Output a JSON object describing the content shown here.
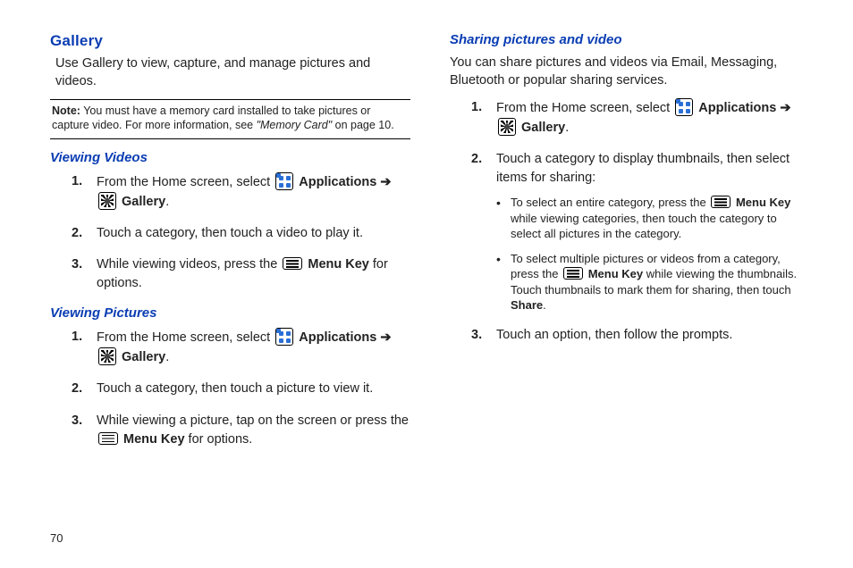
{
  "pageNumber": "70",
  "left": {
    "h1": "Gallery",
    "intro": "Use Gallery to view, capture, and manage pictures and videos.",
    "noteLabel": "Note:",
    "noteBody1": " You must have a memory card installed to take pictures or capture video. For more information, see ",
    "noteQuoted": "\"Memory Card\"",
    "noteBody2": " on page 10.",
    "sec1": {
      "title": "Viewing Videos",
      "s1a": "From the Home screen, select ",
      "s1apps": " Applications ",
      "s1arrow": "➔",
      "s1gal": " Gallery",
      "s1end": ".",
      "s2": "Touch a category, then touch a video to play it.",
      "s3a": "While viewing videos, press the ",
      "s3menu": " Menu Key",
      "s3b": " for options."
    },
    "sec2": {
      "title": "Viewing Pictures",
      "s1a": "From the Home screen, select ",
      "s1apps": " Applications ",
      "s1arrow": "➔",
      "s1gal": " Gallery",
      "s1end": ".",
      "s2": "Touch a category, then touch a picture to view it.",
      "s3a": "While viewing a picture, tap on the screen or press the ",
      "s3menu": " Menu Key",
      "s3b": " for options."
    }
  },
  "right": {
    "title": "Sharing pictures and video",
    "intro": "You can share pictures and videos via Email, Messaging, Bluetooth or popular sharing services.",
    "s1a": "From the Home screen, select ",
    "s1apps": " Applications ",
    "s1arrow": "➔",
    "s1gal": " Gallery",
    "s1end": ".",
    "s2": "Touch a category to display thumbnails, then select items for sharing:",
    "b1a": "To select an entire category, press the ",
    "b1menu": " Menu Key",
    "b1b": " while viewing categories, then touch the category to select all pictures in the category.",
    "b2a": "To select multiple pictures or videos from a category, press the ",
    "b2menu": " Menu Key",
    "b2b": " while viewing the thumbnails. Touch thumbnails to mark them for sharing, then touch ",
    "b2share": "Share",
    "b2end": ".",
    "s3": "Touch an option, then follow the prompts."
  },
  "nums": {
    "n1": "1.",
    "n2": "2.",
    "n3": "3."
  }
}
